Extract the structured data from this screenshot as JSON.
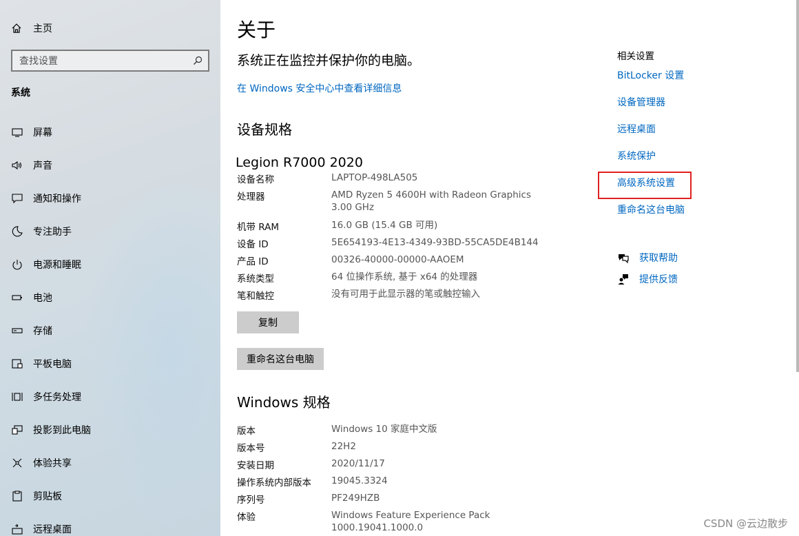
{
  "sidebar": {
    "home_label": "主页",
    "search_placeholder": "查找设置",
    "section_title": "系统",
    "items": [
      {
        "label": "屏幕",
        "icon": "display-icon"
      },
      {
        "label": "声音",
        "icon": "speaker-icon"
      },
      {
        "label": "通知和操作",
        "icon": "notification-icon"
      },
      {
        "label": "专注助手",
        "icon": "moon-icon"
      },
      {
        "label": "电源和睡眠",
        "icon": "power-icon"
      },
      {
        "label": "电池",
        "icon": "battery-icon"
      },
      {
        "label": "存储",
        "icon": "storage-icon"
      },
      {
        "label": "平板电脑",
        "icon": "tablet-icon"
      },
      {
        "label": "多任务处理",
        "icon": "multitask-icon"
      },
      {
        "label": "投影到此电脑",
        "icon": "project-icon"
      },
      {
        "label": "体验共享",
        "icon": "share-icon"
      },
      {
        "label": "剪贴板",
        "icon": "clipboard-icon"
      },
      {
        "label": "远程桌面",
        "icon": "remote-desktop-icon"
      }
    ]
  },
  "main": {
    "title": "关于",
    "protect_text": "系统正在监控并保护你的电脑。",
    "security_link": "在 Windows 安全中心中查看详细信息",
    "device_spec_title": "设备规格",
    "device_model": "Legion R7000 2020",
    "device_specs": [
      {
        "key": "设备名称",
        "value": "LAPTOP-498LA505"
      },
      {
        "key": "处理器",
        "value": "AMD Ryzen 5 4600H with Radeon Graphics",
        "value2": "3.00 GHz"
      },
      {
        "key": "机带 RAM",
        "value": "16.0 GB (15.4 GB 可用)"
      },
      {
        "key": "设备 ID",
        "value": "5E654193-4E13-4349-93BD-55CA5DE4B144"
      },
      {
        "key": "产品 ID",
        "value": "00326-40000-00000-AAOEM"
      },
      {
        "key": "系统类型",
        "value": "64 位操作系统, 基于 x64 的处理器"
      },
      {
        "key": "笔和触控",
        "value": "没有可用于此显示器的笔或触控输入"
      }
    ],
    "copy_button": "复制",
    "rename_button": "重命名这台电脑",
    "windows_spec_title": "Windows 规格",
    "windows_specs": [
      {
        "key": "版本",
        "value": "Windows 10 家庭中文版"
      },
      {
        "key": "版本号",
        "value": "22H2"
      },
      {
        "key": "安装日期",
        "value": "2020/11/17"
      },
      {
        "key": "操作系统内部版本",
        "value": "19045.3324"
      },
      {
        "key": "序列号",
        "value": "PF249HZB"
      },
      {
        "key": "体验",
        "value": "Windows Feature Experience Pack",
        "value2": "1000.19041.1000.0"
      }
    ]
  },
  "related": {
    "title": "相关设置",
    "links": [
      "BitLocker 设置",
      "设备管理器",
      "远程桌面",
      "系统保护",
      "高级系统设置",
      "重命名这台电脑"
    ],
    "help_label": "获取帮助",
    "feedback_label": "提供反馈"
  },
  "watermark": "CSDN @云边散步",
  "colors": {
    "link": "#0067c0",
    "highlight": "#e02020",
    "button": "#cccccc"
  }
}
